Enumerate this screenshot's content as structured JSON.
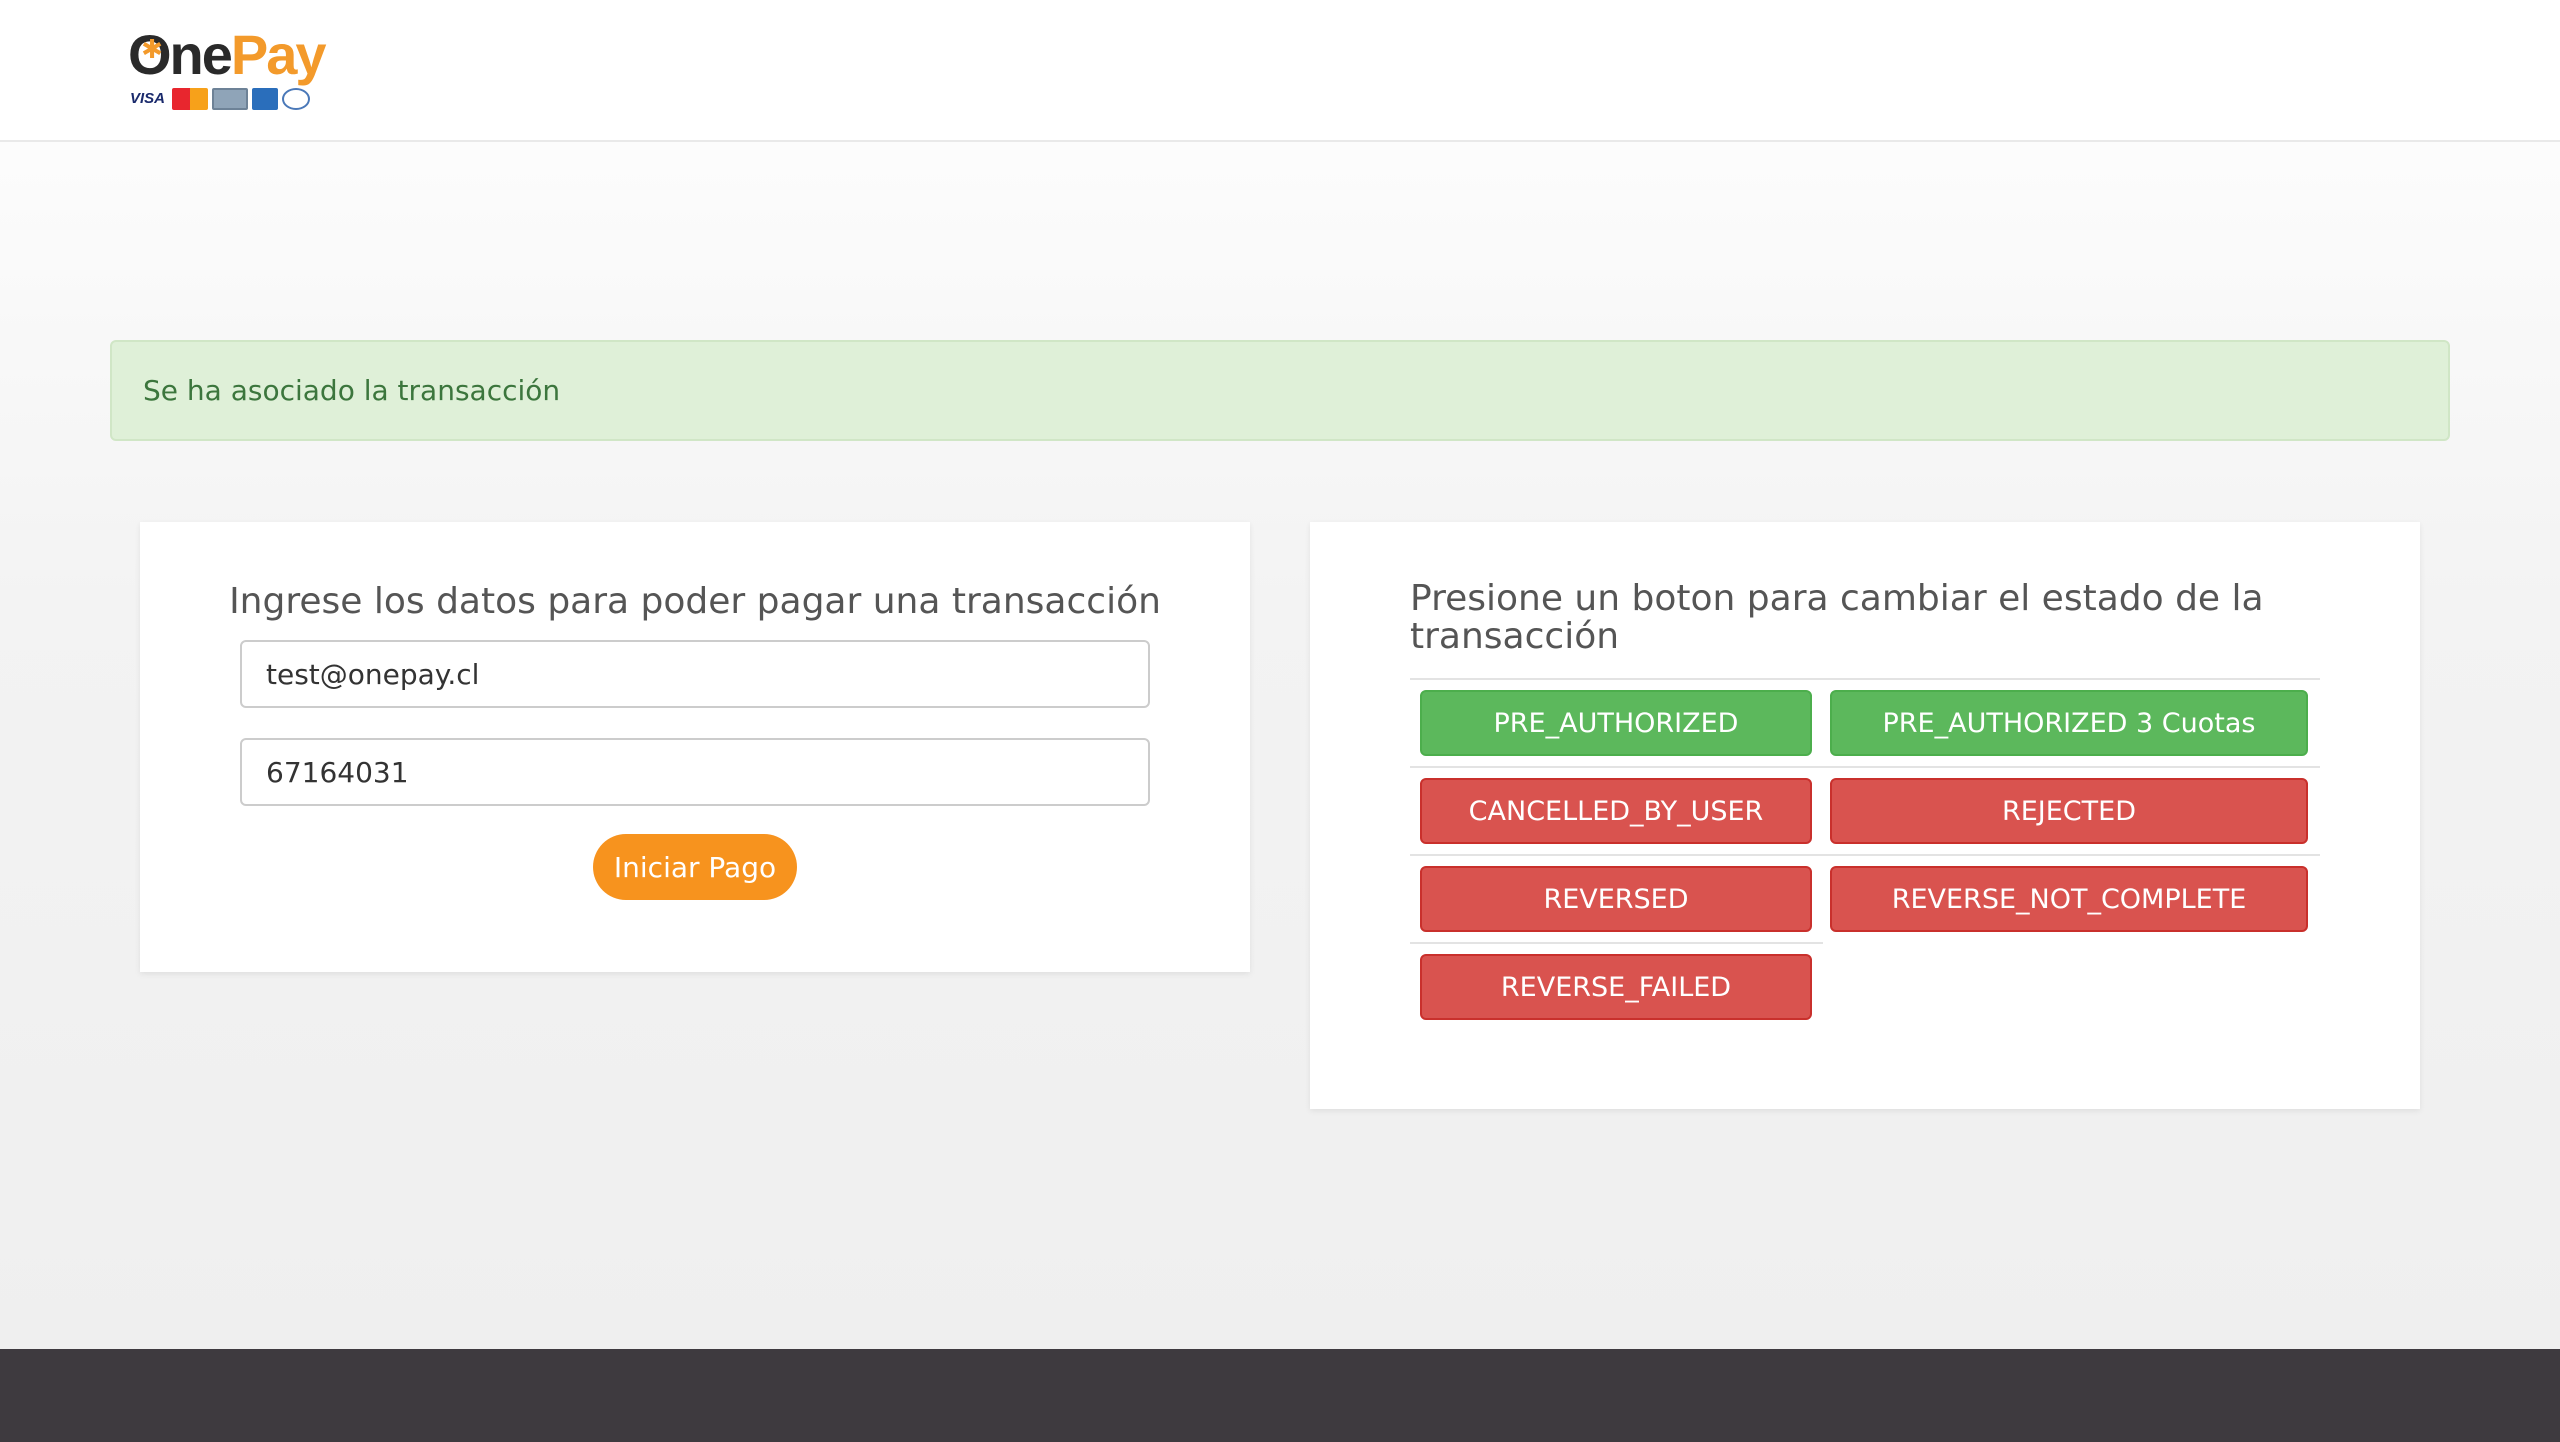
{
  "header": {
    "logo": {
      "one": "One",
      "pay": "Pay",
      "cards": [
        "VISA",
        "MasterCard",
        "MAGNA",
        "American Express",
        "Diners Club"
      ]
    }
  },
  "alert": {
    "message": "Se ha asociado la transacción"
  },
  "payment_form": {
    "title": "Ingrese los datos para poder pagar una transacción",
    "email_value": "test@onepay.cl",
    "phone_value": "67164031",
    "submit_label": "Iniciar Pago"
  },
  "state_panel": {
    "title": "Presione un boton para cambiar el estado de la transacción",
    "buttons": [
      {
        "label": "PRE_AUTHORIZED",
        "style": "success"
      },
      {
        "label": "PRE_AUTHORIZED 3 Cuotas",
        "style": "success"
      },
      {
        "label": "CANCELLED_BY_USER",
        "style": "danger"
      },
      {
        "label": "REJECTED",
        "style": "danger"
      },
      {
        "label": "REVERSED",
        "style": "danger"
      },
      {
        "label": "REVERSE_NOT_COMPLETE",
        "style": "danger"
      },
      {
        "label": "REVERSE_FAILED",
        "style": "danger"
      }
    ]
  },
  "colors": {
    "brand_orange": "#f7931e",
    "success": "#5cb85c",
    "danger": "#d9534f",
    "alert_bg": "#dff0d8",
    "footer": "#3e3a3f"
  }
}
